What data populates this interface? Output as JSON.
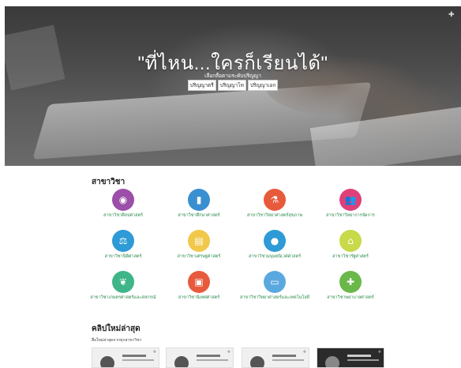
{
  "hero": {
    "title": "\"ที่ไหน...ใครก็เรียนได้\"",
    "subtitle": "เลือกสื่อตามระดับปริญญา",
    "degree_links": [
      "ปริญญาตรี",
      "ปริญญาโท",
      "ปริญญาเอก"
    ]
  },
  "majors": {
    "title": "สาขาวิชา",
    "items": [
      {
        "label": "สาขาวิชาศิลปศาสตร์",
        "color": "#9b4fa8",
        "icon": "eye-icon"
      },
      {
        "label": "สาขาวิชาศึกษาศาสตร์",
        "color": "#3a8fd1",
        "icon": "books-icon"
      },
      {
        "label": "สาขาวิชาวิทยาศาสตร์สุขภาพ",
        "color": "#e85a3c",
        "icon": "flask-icon"
      },
      {
        "label": "สาขาวิชาวิทยาการจัดการ",
        "color": "#e0407a",
        "icon": "people-icon"
      },
      {
        "label": "สาขาวิชานิติศาสตร์",
        "color": "#2e9ad6",
        "icon": "scales-icon"
      },
      {
        "label": "สาขาวิชาเศรษฐศาสตร์",
        "color": "#f2c84b",
        "icon": "chart-icon"
      },
      {
        "label": "สาขาวิชามนุษยนิเวศศาสตร์",
        "color": "#2e9ad6",
        "icon": "person-icon"
      },
      {
        "label": "สาขาวิชารัฐศาสตร์",
        "color": "#c8d94a",
        "icon": "building-icon"
      },
      {
        "label": "สาขาวิชาเกษตรศาสตร์และสหกรณ์",
        "color": "#3fb58a",
        "icon": "leaf-icon"
      },
      {
        "label": "สาขาวิชานิเทศศาสตร์",
        "color": "#e85a3c",
        "icon": "camera-icon"
      },
      {
        "label": "สาขาวิชาวิทยาศาสตร์และเทคโนโลยี",
        "color": "#5aa8e0",
        "icon": "monitor-icon"
      },
      {
        "label": "สาขาวิชาพยาบาลศาสตร์",
        "color": "#6ab84a",
        "icon": "cross-icon"
      }
    ]
  },
  "clips": {
    "title": "คลิปใหม่ล่าสุด",
    "subtitle": "สื่อใหม่ล่าสุดจากทุกสาขาวิชา",
    "count": 4
  }
}
